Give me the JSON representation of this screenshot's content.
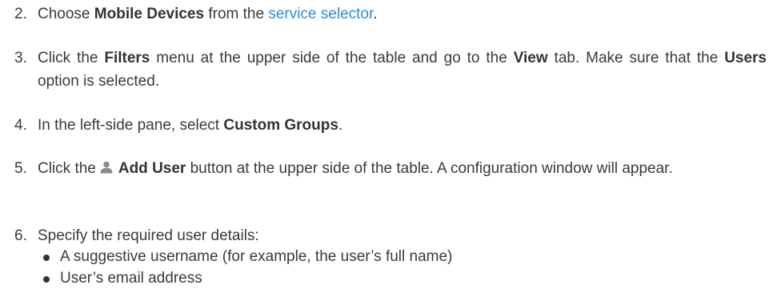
{
  "steps": [
    {
      "number": "2.",
      "before": "Choose ",
      "bold": "Mobile Devices",
      "middle": " from the ",
      "link": "service selector",
      "after": "."
    },
    {
      "number": "3.",
      "t1": "Click the ",
      "b1": "Filters",
      "t2": " menu at the upper side of the table and go to the ",
      "b2": "View",
      "t3": " tab. Make sure that the ",
      "b3": "Users",
      "t4": " option is selected."
    },
    {
      "number": "4.",
      "t1": "In the left-side pane, select ",
      "b1": "Custom Groups",
      "t2": "."
    },
    {
      "number": "5.",
      "t1": "Click the",
      "icon": "user-icon",
      "b1": "Add User",
      "t2": " button at the upper side of the table. A configuration window will appear."
    },
    {
      "number": "6.",
      "t1": "Specify the required user details:",
      "bullets": [
        "A suggestive username (for example, the user’s full name)",
        "User’s email address"
      ]
    }
  ],
  "colors": {
    "text": "#3a3a3a",
    "link": "#2a8fd6",
    "icon": "#8a8a8a"
  }
}
